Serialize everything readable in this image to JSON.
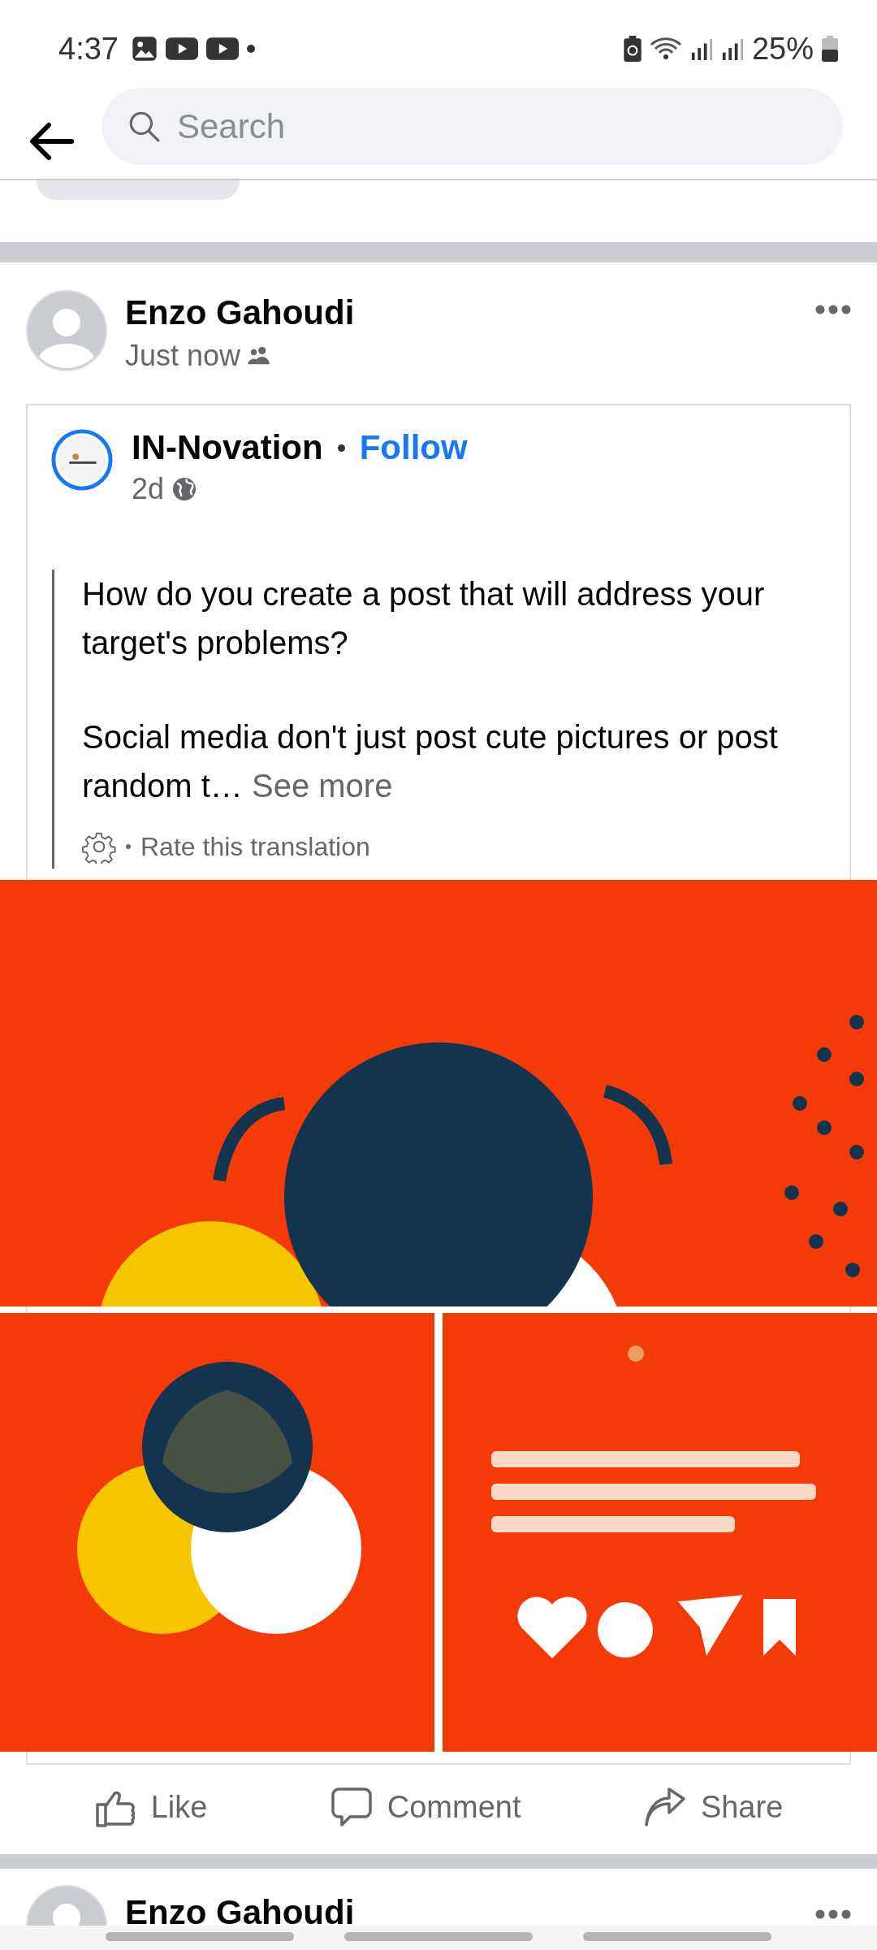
{
  "status_bar": {
    "time": "4:37",
    "battery": "25%"
  },
  "search": {
    "placeholder": "Search"
  },
  "post": {
    "author": "Enzo Gahoudi",
    "time": "Just now"
  },
  "shared": {
    "page": "IN-Novation",
    "follow": "Follow",
    "time": "2d",
    "paragraphs": [
      "How do you create a post that will address your target's problems?",
      "Social media don't just post cute pictures or post random t…"
    ],
    "see_more": "See more",
    "rate": "Rate this translation",
    "images": [
      {
        "kind": "picture"
      },
      {
        "kind": "picture"
      },
      {
        "kind": "picture"
      }
    ]
  },
  "actions": [
    {
      "kind": "like",
      "label": "Like"
    },
    {
      "kind": "comment",
      "label": "Comment"
    },
    {
      "kind": "share",
      "label": "Share"
    }
  ],
  "next_post": {
    "author": "Enzo Gahoudi"
  }
}
